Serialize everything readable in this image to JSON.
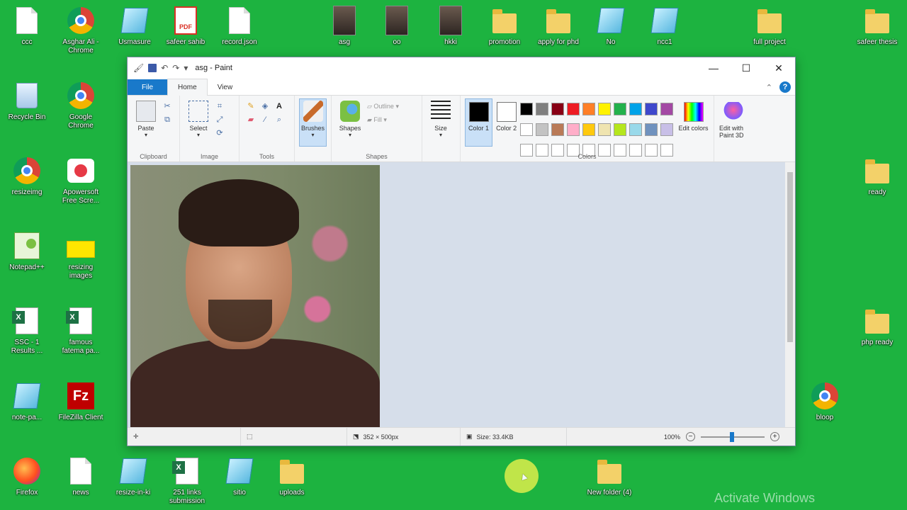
{
  "desktop": {
    "top_row": [
      {
        "label": "ccc",
        "icon": "file"
      },
      {
        "label": "Asghar Ali - Chrome",
        "icon": "chrome"
      },
      {
        "label": "Usmasure",
        "icon": "note"
      },
      {
        "label": "safeer sahib",
        "icon": "pdf"
      },
      {
        "label": "record.json",
        "icon": "file"
      },
      {
        "label": "asg",
        "icon": "photo"
      },
      {
        "label": "oo",
        "icon": "photo"
      },
      {
        "label": "hkki",
        "icon": "photo"
      },
      {
        "label": "promotion",
        "icon": "folder"
      },
      {
        "label": "apply for phd",
        "icon": "folder"
      },
      {
        "label": "No",
        "icon": "note"
      },
      {
        "label": "ncc1",
        "icon": "note"
      },
      {
        "label": "full project",
        "icon": "folder"
      },
      {
        "label": "safeer thesis",
        "icon": "folder"
      }
    ],
    "left_col1": [
      {
        "label": "Recycle Bin",
        "icon": "recycle"
      },
      {
        "label": "resizeimg",
        "icon": "chrome"
      },
      {
        "label": "Notepad++",
        "icon": "notepadpp"
      },
      {
        "label": "SSC - 1 Results ...",
        "icon": "excel"
      },
      {
        "label": "note-pa...",
        "icon": "note"
      },
      {
        "label": "Firefox",
        "icon": "firefox"
      }
    ],
    "left_col2": [
      {
        "label": "Google Chrome",
        "icon": "chrome"
      },
      {
        "label": "Apowersoft Free Scre...",
        "icon": "cam"
      },
      {
        "label": "resizing images",
        "icon": "sticky"
      },
      {
        "label": "famous fatema pa...",
        "icon": "excel"
      },
      {
        "label": "FileZilla Client",
        "icon": "filezilla"
      },
      {
        "label": "news",
        "icon": "file"
      }
    ],
    "bottom_row": [
      {
        "label": "resize-in-ki",
        "icon": "note"
      },
      {
        "label": "251 links submission",
        "icon": "excel"
      },
      {
        "label": "sitio",
        "icon": "note"
      },
      {
        "label": "uploads",
        "icon": "folder"
      },
      {
        "label": "New folder (4)",
        "icon": "folder"
      }
    ],
    "right_col": [
      {
        "label": "ready",
        "icon": "folder"
      },
      {
        "label": "php ready",
        "icon": "folder"
      },
      {
        "label": "bloop",
        "icon": "chrome"
      }
    ],
    "watermark": "Activate Windows"
  },
  "paint": {
    "title": "asg - Paint",
    "tabs": [
      "File",
      "Home",
      "View"
    ],
    "clipboard": {
      "paste": "Paste",
      "group": "Clipboard"
    },
    "image": {
      "select": "Select",
      "group": "Image"
    },
    "tools": {
      "group": "Tools"
    },
    "brushes": "Brushes",
    "shapes": {
      "label": "Shapes",
      "outline": "Outline",
      "fill": "Fill",
      "group": "Shapes"
    },
    "size": "Size",
    "color1": "Color 1",
    "color2": "Color 2",
    "edit_colors": "Edit colors",
    "edit_paint3d": "Edit with Paint 3D",
    "colors_group": "Colors",
    "palette": [
      "#000000",
      "#7f7f7f",
      "#880015",
      "#ed1c24",
      "#ff7f27",
      "#fff200",
      "#22b14c",
      "#00a2e8",
      "#3f48cc",
      "#a349a4",
      "#ffffff",
      "#c3c3c3",
      "#b97a57",
      "#ffaec9",
      "#ffc90e",
      "#efe4b0",
      "#b5e61d",
      "#99d9ea",
      "#7092be",
      "#c8bfe7",
      "#ffffff",
      "#ffffff",
      "#ffffff",
      "#ffffff",
      "#ffffff",
      "#ffffff",
      "#ffffff",
      "#ffffff",
      "#ffffff",
      "#ffffff"
    ],
    "status": {
      "dimensions": "352 × 500px",
      "size": "Size: 33.4KB",
      "zoom": "100%"
    }
  }
}
